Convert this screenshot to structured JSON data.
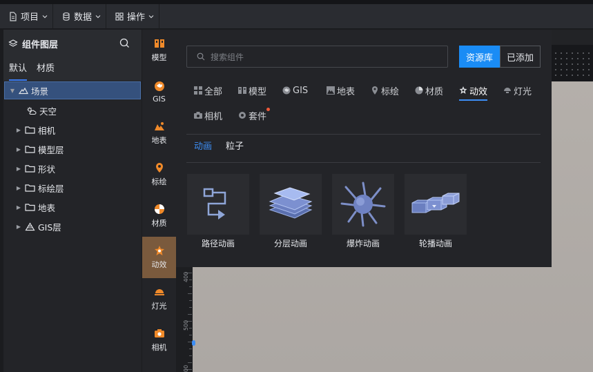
{
  "menubar": {
    "items": [
      {
        "label": "项目",
        "icon": "document-icon"
      },
      {
        "label": "数据",
        "icon": "database-icon"
      },
      {
        "label": "操作",
        "icon": "grid-icon"
      }
    ]
  },
  "layer_panel": {
    "title": "组件图层",
    "tabs": [
      {
        "label": "默认",
        "active": true
      },
      {
        "label": "材质",
        "active": false
      }
    ],
    "tree": [
      {
        "label": "场景",
        "icon": "scene-icon",
        "selected": true,
        "expanded": true,
        "level": 0
      },
      {
        "label": "天空",
        "icon": "sky-icon",
        "level": 1
      },
      {
        "label": "相机",
        "icon": "folder-icon",
        "level": 0
      },
      {
        "label": "模型层",
        "icon": "folder-icon",
        "level": 0
      },
      {
        "label": "形状",
        "icon": "folder-icon",
        "level": 0
      },
      {
        "label": "标绘层",
        "icon": "folder-icon",
        "level": 0
      },
      {
        "label": "地表",
        "icon": "folder-icon",
        "level": 0
      },
      {
        "label": "GIS层",
        "icon": "gis-layer-icon",
        "level": 0
      }
    ]
  },
  "sidebar": {
    "items": [
      {
        "label": "模型",
        "icon": "model-icon"
      },
      {
        "label": "GIS",
        "icon": "gis-icon"
      },
      {
        "label": "地表",
        "icon": "terrain-icon"
      },
      {
        "label": "标绘",
        "icon": "marker-icon"
      },
      {
        "label": "材质",
        "icon": "material-icon"
      },
      {
        "label": "动效",
        "icon": "effect-icon",
        "active": true
      },
      {
        "label": "灯光",
        "icon": "light-icon"
      },
      {
        "label": "相机",
        "icon": "camera-icon"
      }
    ]
  },
  "popup": {
    "search_placeholder": "搜索组件",
    "toggle_library": "资源库",
    "toggle_added": "已添加",
    "categories": [
      {
        "label": "全部",
        "icon": "all-icon"
      },
      {
        "label": "模型",
        "icon": "model-icon"
      },
      {
        "label": "GIS",
        "icon": "gis-icon"
      },
      {
        "label": "地表",
        "icon": "terrain-icon"
      },
      {
        "label": "标绘",
        "icon": "marker-icon"
      },
      {
        "label": "材质",
        "icon": "material-icon"
      },
      {
        "label": "动效",
        "icon": "effect-icon",
        "active": true
      },
      {
        "label": "灯光",
        "icon": "light-icon"
      },
      {
        "label": "相机",
        "icon": "camera-icon"
      },
      {
        "label": "套件",
        "icon": "kit-icon",
        "badge": true
      }
    ],
    "subtabs": [
      {
        "label": "动画",
        "active": true
      },
      {
        "label": "粒子",
        "active": false
      }
    ],
    "cards": [
      {
        "label": "路径动画",
        "icon": "path-animation-icon"
      },
      {
        "label": "分层动画",
        "icon": "layer-animation-icon"
      },
      {
        "label": "爆炸动画",
        "icon": "explosion-animation-icon"
      },
      {
        "label": "轮播动画",
        "icon": "carousel-animation-icon"
      }
    ]
  },
  "ruler": {
    "labels": [
      "400",
      "500",
      "00"
    ]
  },
  "colors": {
    "accent": "#1a8cf5",
    "active_sidebar": "#7a5a3d",
    "selection": "#35517d"
  }
}
